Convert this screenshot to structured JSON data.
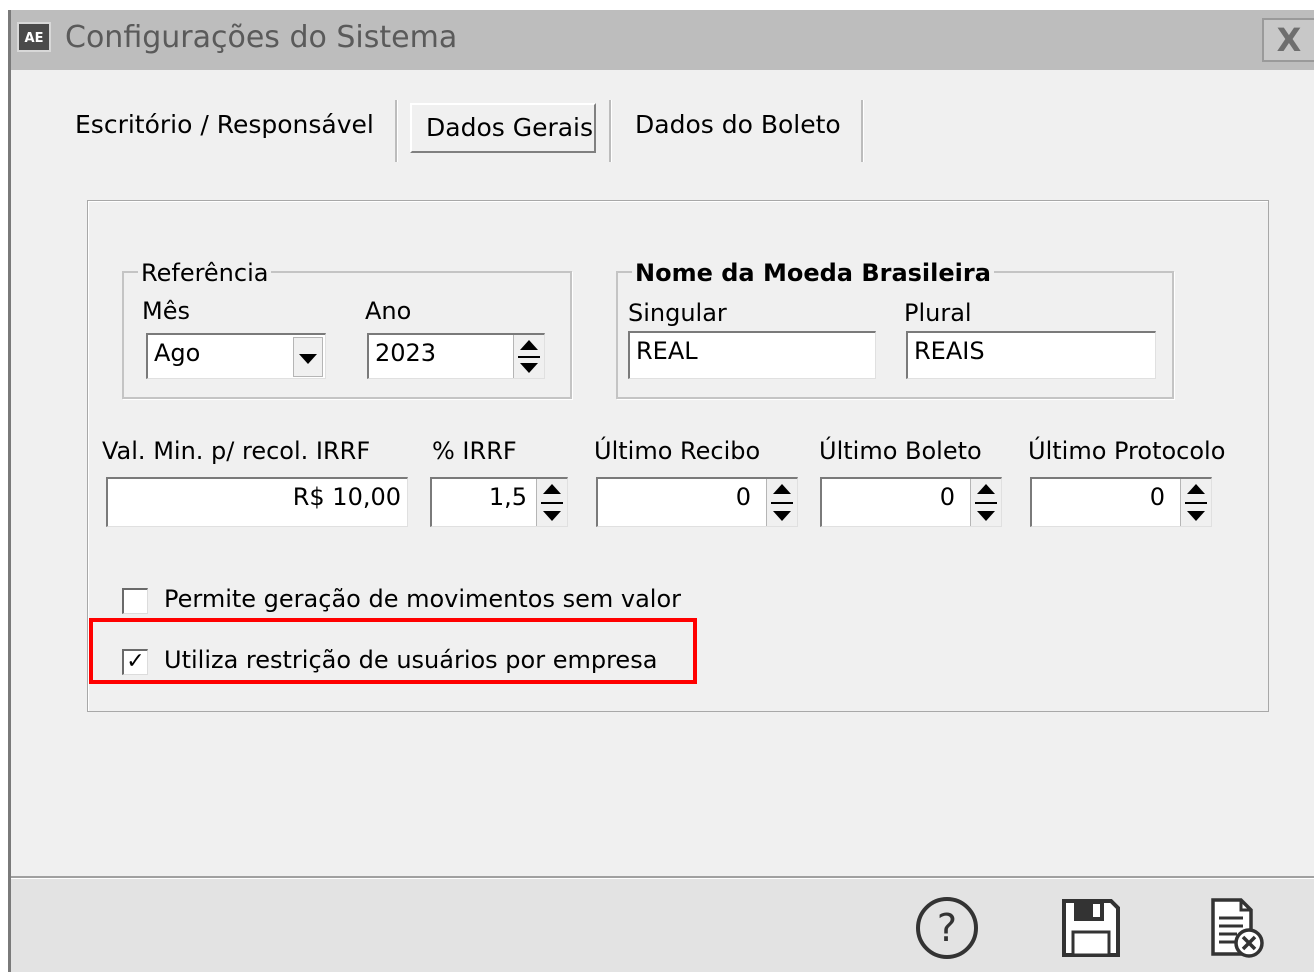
{
  "window": {
    "title": "Configurações do Sistema",
    "app_icon": "AE",
    "close_label": "X"
  },
  "tabs": [
    {
      "label": "Escritório / Responsável",
      "active": false
    },
    {
      "label": "Dados Gerais",
      "active": true
    },
    {
      "label": "Dados do Boleto",
      "active": false
    }
  ],
  "referencia": {
    "legend": "Referência",
    "mes_label": "Mês",
    "mes_value": "Ago",
    "ano_label": "Ano",
    "ano_value": "2023"
  },
  "moeda": {
    "legend": "Nome da Moeda Brasileira",
    "singular_label": "Singular",
    "singular_value": "REAL",
    "plural_label": "Plural",
    "plural_value": "REAIS"
  },
  "fields": {
    "val_min_label": "Val. Min. p/ recol. IRRF",
    "val_min_value": "R$ 10,00",
    "irrf_label": "% IRRF",
    "irrf_value": "1,5",
    "recibo_label": "Último Recibo",
    "recibo_value": "0",
    "boleto_label": "Último Boleto",
    "boleto_value": "0",
    "protocolo_label": "Último Protocolo",
    "protocolo_value": "0"
  },
  "options": {
    "permite_label": "Permite geração de movimentos sem valor",
    "permite_checked": false,
    "restricao_label": "Utiliza restrição de usuários por empresa",
    "restricao_checked": true,
    "check_mark": "✓"
  },
  "toolbar": {
    "help_icon": "help-icon",
    "save_icon": "save-icon",
    "cancel_icon": "cancel-document-icon"
  },
  "colors": {
    "highlight": "#ff0000",
    "window_bg": "#f0f0f0",
    "titlebar": "#bdbdbd"
  }
}
